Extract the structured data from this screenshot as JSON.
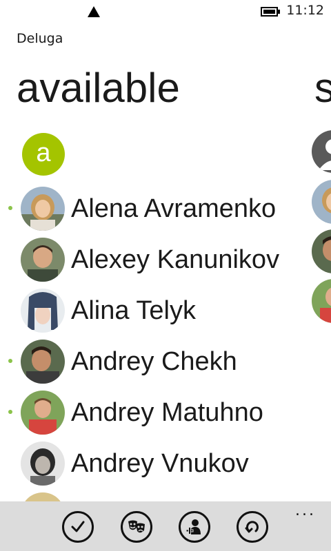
{
  "status_bar": {
    "time": "11:12",
    "signal_icon": "signal-triangle-icon",
    "battery_icon": "battery-icon"
  },
  "app": {
    "title": "Deluga"
  },
  "pivot": {
    "current": "available",
    "next_peek": "s"
  },
  "group": {
    "letter": "a",
    "color": "#a4c400"
  },
  "contacts": [
    {
      "name": "Alena Avramenko",
      "online": true
    },
    {
      "name": "Alexey Kanunikov",
      "online": false
    },
    {
      "name": "Alina Telyk",
      "online": false
    },
    {
      "name": "Andrey Chekh",
      "online": true
    },
    {
      "name": "Andrey Matuhno",
      "online": true
    },
    {
      "name": "Andrey Vnukov",
      "online": false
    }
  ],
  "colors": {
    "accent": "#a4c400",
    "presence": "#8bc34a",
    "app_bar": "#dcdcdc"
  },
  "app_bar": {
    "buttons": [
      {
        "icon": "check-icon"
      },
      {
        "icon": "mood-masks-icon"
      },
      {
        "icon": "add-contact-icon"
      },
      {
        "icon": "refresh-icon"
      }
    ],
    "more": "..."
  }
}
